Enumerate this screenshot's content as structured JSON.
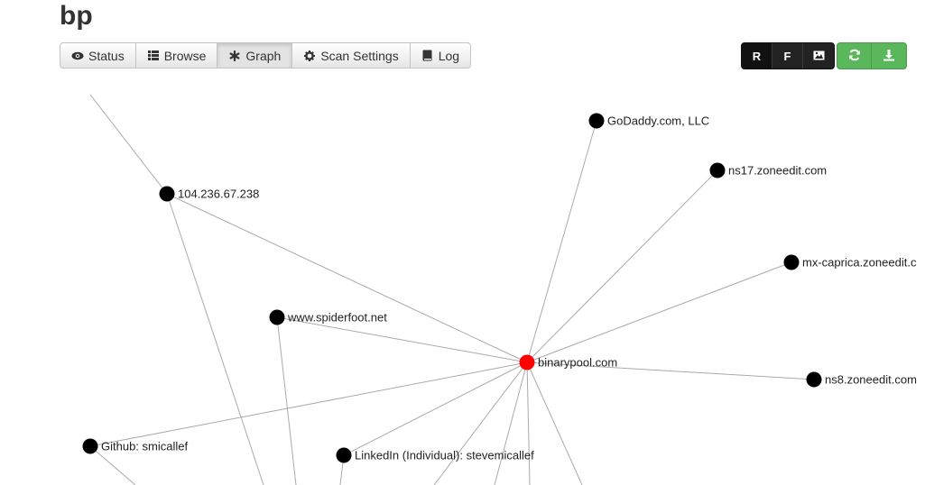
{
  "scan": {
    "title": "bp"
  },
  "tabs": [
    {
      "label": "Status",
      "icon": "eye-icon"
    },
    {
      "label": "Browse",
      "icon": "list-icon"
    },
    {
      "label": "Graph",
      "icon": "asterisk-icon",
      "active": true
    },
    {
      "label": "Scan Settings",
      "icon": "gear-icon"
    },
    {
      "label": "Log",
      "icon": "book-icon"
    }
  ],
  "toolbar": {
    "graph_mode_buttons": [
      {
        "label": "R",
        "active": true
      },
      {
        "label": "F"
      },
      {
        "label": "",
        "icon": "image-icon"
      }
    ],
    "action_buttons": [
      {
        "icon": "refresh-icon"
      },
      {
        "icon": "download-icon"
      }
    ],
    "colors": {
      "dark": "#222222",
      "green": "#5bb75b"
    }
  },
  "graph": {
    "colors": {
      "root": "#ff0000",
      "node": "#000000",
      "edge": "#aaaaaa"
    },
    "nodes": [
      {
        "id": "root",
        "label": "binarypool.com",
        "root": true
      },
      {
        "id": "godaddy",
        "label": "GoDaddy.com, LLC"
      },
      {
        "id": "ns17",
        "label": "ns17.zoneedit.com"
      },
      {
        "id": "mxcaprica",
        "label": "mx-caprica.zoneedit.c"
      },
      {
        "id": "ns8",
        "label": "ns8.zoneedit.com"
      },
      {
        "id": "ip",
        "label": "104.236.67.238"
      },
      {
        "id": "spiderfoot",
        "label": "www.spiderfoot.net"
      },
      {
        "id": "github",
        "label": "Github: smicallef"
      },
      {
        "id": "linkedin",
        "label": "LinkedIn (Individual): stevemicallef"
      }
    ],
    "edges": [
      [
        "root",
        "godaddy"
      ],
      [
        "root",
        "ns17"
      ],
      [
        "root",
        "mxcaprica"
      ],
      [
        "root",
        "ns8"
      ],
      [
        "root",
        "ip"
      ],
      [
        "root",
        "spiderfoot"
      ],
      [
        "root",
        "github"
      ],
      [
        "root",
        "linkedin"
      ],
      [
        "ip",
        "offscreen-top"
      ],
      [
        "ip",
        "offscreen-bottom-1"
      ],
      [
        "spiderfoot",
        "offscreen-bottom-2"
      ],
      [
        "github",
        "offscreen-bottom-3"
      ],
      [
        "linkedin",
        "offscreen-bottom-4"
      ],
      [
        "root",
        "offscreen-bottom-5"
      ],
      [
        "root",
        "offscreen-bottom-6"
      ],
      [
        "root",
        "offscreen-bottom-7"
      ],
      [
        "root",
        "offscreen-bottom-8"
      ]
    ]
  }
}
